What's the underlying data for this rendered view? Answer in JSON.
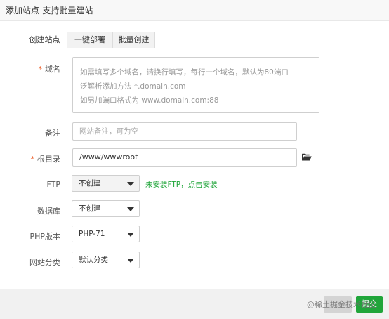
{
  "dialog": {
    "title": "添加站点-支持批量建站"
  },
  "tabs": [
    {
      "label": "创建站点",
      "active": true
    },
    {
      "label": "一键部署",
      "active": false
    },
    {
      "label": "批量创建",
      "active": false
    }
  ],
  "form": {
    "domain": {
      "required_mark": "*",
      "label": "域名",
      "placeholder_lines": [
        "如需填写多个域名，请换行填写，每行一个域名，默认为80端口",
        "泛解析添加方法 *.domain.com",
        "如另加端口格式为 www.domain.com:88"
      ]
    },
    "remark": {
      "label": "备注",
      "placeholder": "网站备注，可为空"
    },
    "root": {
      "required_mark": "*",
      "label": "根目录",
      "value": "/www/wwwroot",
      "icon": "folder-open-icon"
    },
    "ftp": {
      "label": "FTP",
      "selected": "不创建",
      "hint": "未安装FTP，点击安装"
    },
    "database": {
      "label": "数据库",
      "selected": "不创建"
    },
    "php": {
      "label": "PHP版本",
      "selected": "PHP-71"
    },
    "category": {
      "label": "网站分类",
      "selected": "默认分类"
    }
  },
  "footer": {
    "submit_label": "提交",
    "watermark": "@稀土掘金技术社区"
  },
  "colors": {
    "accent": "#20a53a",
    "required": "#e63"
  }
}
